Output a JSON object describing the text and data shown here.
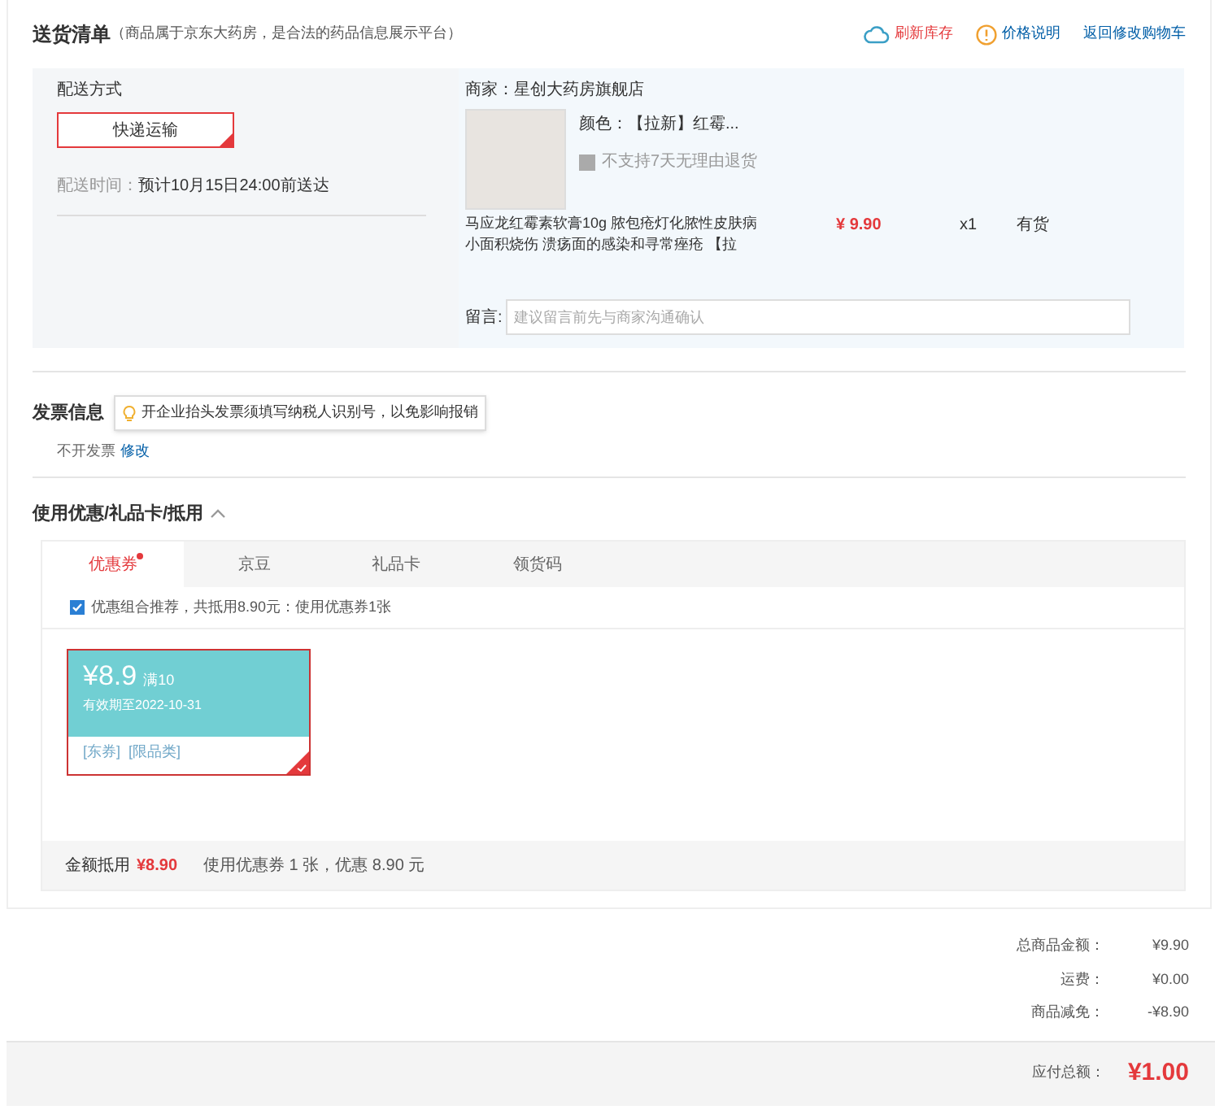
{
  "delivery": {
    "title": "送货清单",
    "note": "（商品属于京东大药房，是合法的药品信息展示平台）",
    "links": [
      {
        "kind": "refresh",
        "label": "刷新库存"
      },
      {
        "kind": "info",
        "label": "价格说明"
      },
      {
        "kind": "plain",
        "label": "返回修改购物车"
      }
    ],
    "method_label": "配送方式",
    "method_option": {
      "label": "快递运输",
      "selected": true
    },
    "time_label": "配送时间：",
    "time_value": "预计10月15日24:00前送达",
    "shop": "商家：星创大药房旗舰店",
    "product": {
      "variant": "颜色：【拉新】红霉...",
      "return_policy": "不支持7天无理由退货",
      "name": "马应龙红霉素软膏10g 脓包疮灯化脓性皮肤病小面积烧伤 溃疡面的感染和寻常痤疮 【拉",
      "price": "¥ 9.90",
      "qty": "x1",
      "stock": "有货"
    },
    "message_label": "留言:",
    "message_placeholder": "建议留言前先与商家沟通确认"
  },
  "invoice": {
    "title": "发票信息",
    "tip": "开企业抬头发票须填写纳税人识别号，以免影响报销",
    "value": "不开发票",
    "edit": "修改"
  },
  "discount": {
    "title": "使用优惠/礼品卡/抵用",
    "expanded": true,
    "tabs": [
      {
        "label": "优惠券",
        "selected": true,
        "dot": true
      },
      {
        "label": "京豆",
        "selected": false,
        "dot": false
      },
      {
        "label": "礼品卡",
        "selected": false,
        "dot": false
      },
      {
        "label": "领货码",
        "selected": false,
        "dot": false
      }
    ],
    "recommend": {
      "label": "优惠组合推荐，共抵用8.90元：使用优惠券1张",
      "checked": true
    },
    "coupon": {
      "amount": "¥8.9",
      "condition": "满10",
      "expiry": "有效期至2022-10-31",
      "tags": "[东券]  [限品类]",
      "selected": true
    },
    "footer_label": "金额抵用",
    "footer_amount": "¥8.90",
    "footer_note": "使用优惠券 1 张，优惠 8.90 元"
  },
  "summary": {
    "rows": [
      {
        "label": "总商品金额：",
        "value": "¥9.90"
      },
      {
        "label": "运费：",
        "value": "¥0.00"
      },
      {
        "label": "商品减免：",
        "value": "-¥8.90"
      }
    ],
    "total_label": "应付总额：",
    "total_value": "¥1.00"
  }
}
